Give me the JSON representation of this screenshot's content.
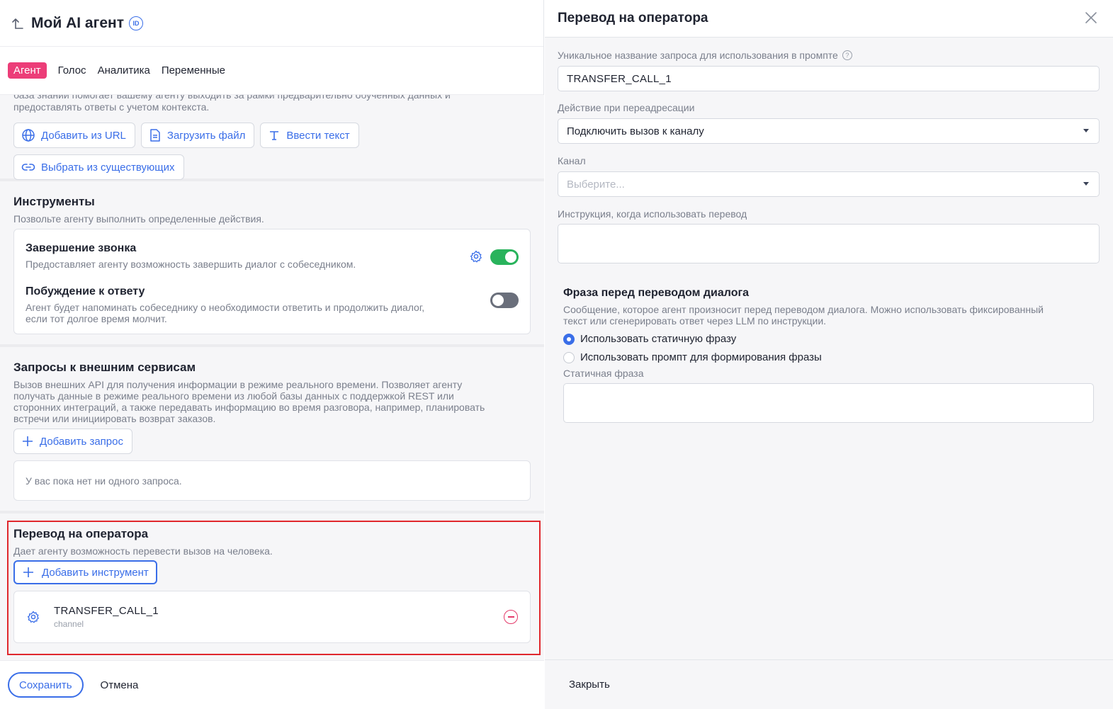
{
  "header": {
    "title": "Мой AI агент",
    "id_badge": "ID"
  },
  "tabs": [
    {
      "label": "Агент",
      "active": true
    },
    {
      "label": "Голос",
      "active": false
    },
    {
      "label": "Аналитика",
      "active": false
    },
    {
      "label": "Переменные",
      "active": false
    }
  ],
  "knowledge": {
    "desc_line1": "база знаний помогает вашему агенту выходить за рамки предварительно обученных данных и",
    "desc_line2": "предоставлять ответы с учетом контекста.",
    "add_url": "Добавить из URL",
    "upload_file": "Загрузить файл",
    "enter_text": "Ввести текст",
    "choose_existing": "Выбрать из существующих"
  },
  "tools": {
    "title": "Инструменты",
    "subtitle": "Позвольте агенту выполнить определенные действия.",
    "end_call": {
      "name": "Завершение звонка",
      "desc": "Предоставляет агенту возможность завершить диалог с собеседником.",
      "enabled": true
    },
    "prompt_reply": {
      "name": "Побуждение к ответу",
      "desc_line1": "Агент будет напоминать собеседнику о необходимости ответить и продолжить диалог,",
      "desc_line2": "если тот долгое время молчит.",
      "enabled": false
    }
  },
  "requests": {
    "title": "Запросы к внешним сервисам",
    "desc_line1": "Вызов внешних API для получения информации в режиме реального времени. Позволяет агенту",
    "desc_line2": "получать данные в режиме реального времени из любой базы данных с поддержкой REST или",
    "desc_line3": "сторонних интеграций, а также передавать информацию во время разговора, например, планировать",
    "desc_line4": "встречи или инициировать возврат заказов.",
    "add_button": "Добавить запрос",
    "empty_text": "У вас пока нет ни одного запроса."
  },
  "transfer": {
    "title": "Перевод на оператора",
    "subtitle": "Дает агенту возможность перевести вызов на человека.",
    "add_button": "Добавить инструмент",
    "item_name": "TRANSFER_CALL_1",
    "item_type": "channel"
  },
  "footer": {
    "save": "Сохранить",
    "cancel": "Отмена"
  },
  "panel": {
    "title": "Перевод на оператора",
    "name_label": "Уникальное название запроса для использования в промпте",
    "name_value": "TRANSFER_CALL_1",
    "action_label": "Действие при переадресации",
    "action_value": "Подключить вызов к каналу",
    "channel_label": "Канал",
    "channel_placeholder": "Выберите...",
    "instruction_label": "Инструкция, когда использовать перевод",
    "phrase_title": "Фраза перед переводом диалога",
    "phrase_desc_line1": "Сообщение, которое агент произносит перед переводом диалога. Можно использовать фиксированный",
    "phrase_desc_line2": "текст или сгенерировать ответ через LLM по инструкции.",
    "radio_static": "Использовать статичную фразу",
    "radio_prompt": "Использовать промпт для формирования фразы",
    "selected_radio": "static",
    "static_label": "Статичная фраза",
    "close_button": "Закрыть"
  },
  "colors": {
    "accent": "#3a6ee8",
    "tab_active": "#ec3d78",
    "toggle_on": "#29b35c",
    "danger": "#e43a6a",
    "highlight": "#e0282d"
  }
}
